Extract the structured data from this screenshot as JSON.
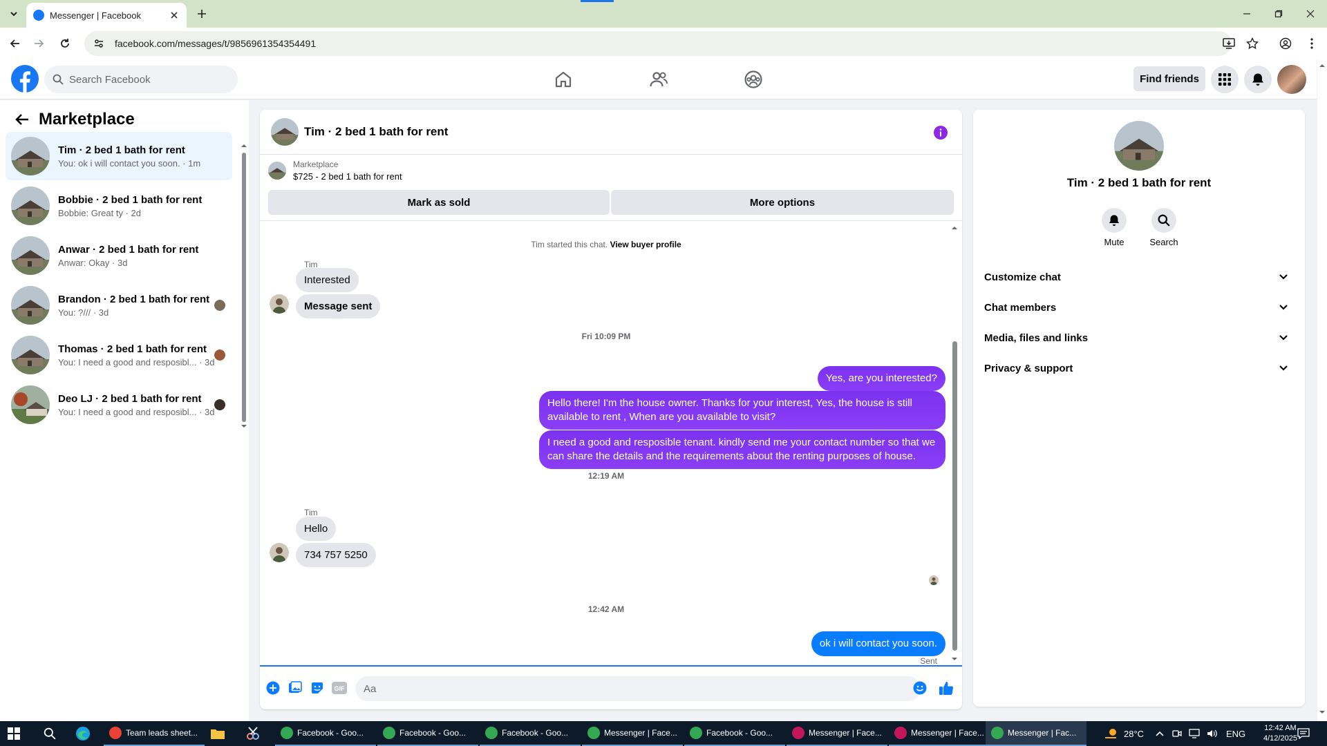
{
  "browser": {
    "tab_title": "Messenger | Facebook",
    "url": "facebook.com/messages/t/9856961354354491"
  },
  "header": {
    "search_placeholder": "Search Facebook",
    "find_friends_label": "Find friends"
  },
  "sidebar": {
    "title": "Marketplace",
    "conversations": [
      {
        "name": "Tim · 2 bed 1 bath for rent",
        "preview": "You: ok i will contact you soon. · 1m",
        "active": true
      },
      {
        "name": "Bobbie · 2 bed 1 bath for rent",
        "preview": "Bobbie: Great ty · 2d"
      },
      {
        "name": "Anwar · 2 bed 1 bath for rent",
        "preview": "Anwar: Okay · 3d"
      },
      {
        "name": "Brandon · 2 bed 1 bath for rent",
        "preview": "You: ?/// · 3d"
      },
      {
        "name": "Thomas · 2 bed 1 bath for rent",
        "preview": "You: I need a good and resposibl... · 3d"
      },
      {
        "name": "Deo LJ · 2 bed 1 bath for rent",
        "preview": "You: I need a good and resposibl... · 3d"
      }
    ]
  },
  "chat": {
    "title": "Tim · 2 bed 1 bath for rent",
    "listing_source": "Marketplace",
    "listing_info": "$725 - 2 bed 1 bath for rent",
    "mark_sold_label": "Mark as sold",
    "more_options_label": "More options",
    "started_text": "Tim started this chat.",
    "view_profile_link": "View buyer profile",
    "sender_name_1": "Tim",
    "msg_in_1": "Interested",
    "msg_in_2": "Message sent",
    "time_1": "Fri 10:09 PM",
    "msg_out_1": "Yes, are you interested?",
    "msg_out_2": "Hello there! I'm the house owner. Thanks for your interest, Yes, the house is still available to rent , When are you available to visit?",
    "msg_out_3": "I need a good and resposible tenant.  kindly send me your contact number so that we can share the details and the requirements about the renting purposes of house.",
    "time_2": "12:19 AM",
    "sender_name_2": "Tim",
    "msg_in_3": "Hello",
    "msg_in_4": "734 757 5250",
    "time_3": "12:42 AM",
    "msg_out_4": "ok i will contact you soon.",
    "sent_label": "Sent",
    "composer_placeholder": "Aa"
  },
  "rpanel": {
    "name": "Tim · 2 bed 1 bath for rent",
    "mute_label": "Mute",
    "search_label": "Search",
    "sections": [
      "Customize chat",
      "Chat members",
      "Media, files and links",
      "Privacy & support"
    ]
  },
  "taskbar": {
    "apps": [
      {
        "label": "Team leads sheet..."
      },
      {
        "label": "Facebook - Goo..."
      },
      {
        "label": "Facebook - Goo..."
      },
      {
        "label": "Facebook - Goo..."
      },
      {
        "label": "Messenger | Face..."
      },
      {
        "label": "Facebook - Goo..."
      },
      {
        "label": "Messenger | Face..."
      },
      {
        "label": "Messenger | Face..."
      },
      {
        "label": "Messenger | Fac..."
      }
    ],
    "weather": "28°C",
    "lang": "ENG",
    "time": "12:42 AM",
    "date": "4/12/2025"
  },
  "colors": {
    "facebook_blue": "#1877f2",
    "messenger_purple": "#7b32f0",
    "active_conv_bg": "#ebf5ff"
  }
}
